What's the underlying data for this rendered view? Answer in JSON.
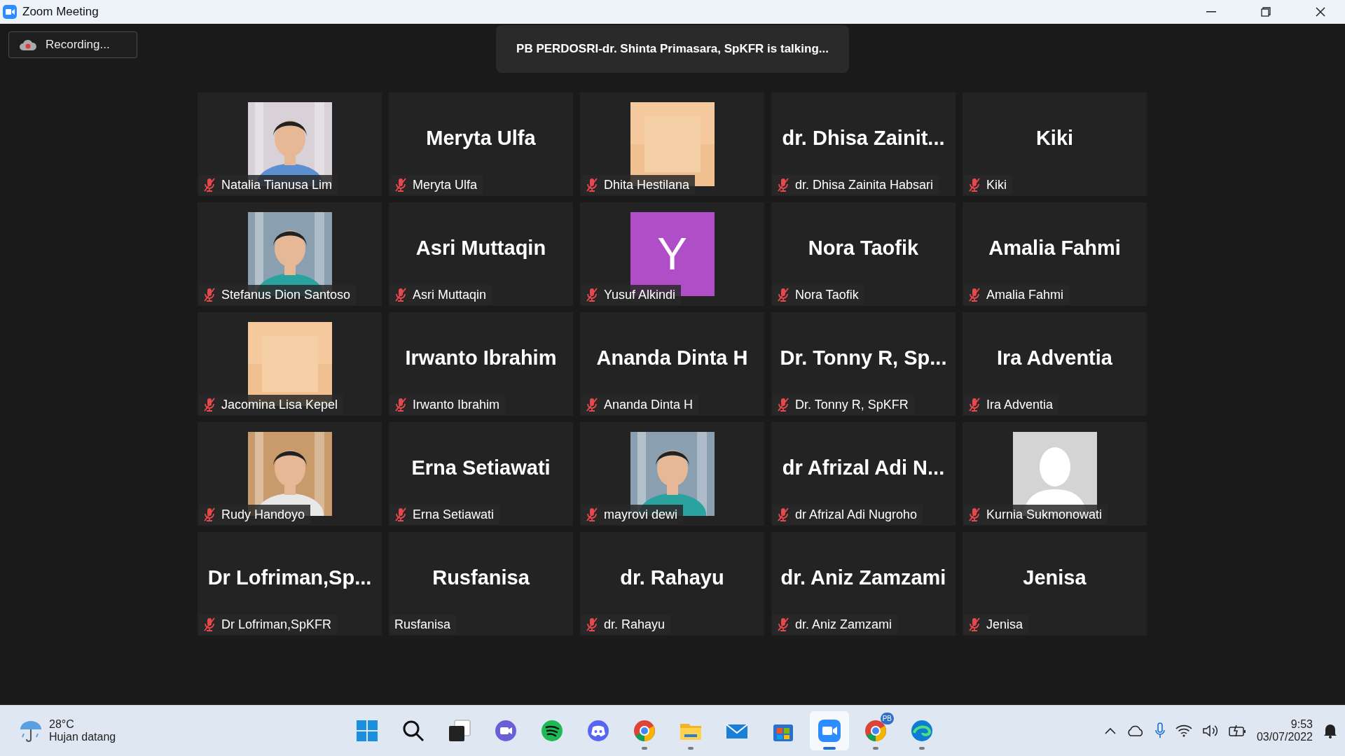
{
  "window": {
    "title": "Zoom Meeting"
  },
  "recording": {
    "label": "Recording..."
  },
  "speaker_banner": {
    "text": "PB PERDOSRI-dr. Shinta Primasara, SpKFR is talking..."
  },
  "tiles": [
    {
      "label": "Natalia Tianusa Lim",
      "muted": true
    },
    {
      "kind": "name",
      "display": "Meryta Ulfa",
      "label": "Meryta Ulfa",
      "muted": true
    },
    {
      "label": "Dhita Hestilana",
      "muted": true
    },
    {
      "kind": "name",
      "display": "dr. Dhisa Zainit...",
      "label": "dr. Dhisa Zainita Habsari",
      "muted": true
    },
    {
      "kind": "name",
      "display": "Kiki",
      "label": "Kiki",
      "muted": true
    },
    {
      "label": "Stefanus Dion Santoso",
      "muted": true
    },
    {
      "kind": "name",
      "display": "Asri Muttaqin",
      "label": "Asri Muttaqin",
      "muted": true
    },
    {
      "kind": "avatar",
      "letter": "Y",
      "color": "#b04ec8",
      "label": "Yusuf Alkindi",
      "muted": true
    },
    {
      "kind": "name",
      "display": "Nora Taofik",
      "label": "Nora Taofik",
      "muted": true
    },
    {
      "kind": "name",
      "display": "Amalia Fahmi",
      "label": "Amalia Fahmi",
      "muted": true
    },
    {
      "label": "Jacomina Lisa Kepel",
      "muted": true
    },
    {
      "kind": "name",
      "display": "Irwanto Ibrahim",
      "label": "Irwanto Ibrahim",
      "muted": true
    },
    {
      "kind": "name",
      "display": "Ananda Dinta H",
      "label": "Ananda Dinta H",
      "muted": true
    },
    {
      "kind": "name",
      "display": "Dr. Tonny R, Sp...",
      "label": "Dr. Tonny R, SpKFR",
      "muted": true
    },
    {
      "kind": "name",
      "display": "Ira Adventia",
      "label": "Ira Adventia",
      "muted": true
    },
    {
      "label": "Rudy Handoyo",
      "muted": true
    },
    {
      "kind": "name",
      "display": "Erna Setiawati",
      "label": "Erna Setiawati",
      "muted": true
    },
    {
      "label": "mayrovi dewi",
      "muted": true
    },
    {
      "kind": "name",
      "display": "dr Afrizal Adi N...",
      "label": "dr Afrizal Adi Nugroho",
      "muted": true
    },
    {
      "kind": "silhouette",
      "label": "Kurnia Sukmonowati",
      "muted": true
    },
    {
      "kind": "name",
      "display": "Dr  Lofriman,Sp...",
      "label": "Dr Lofriman,SpKFR",
      "muted": true
    },
    {
      "kind": "name",
      "display": "Rusfanisa",
      "label": "Rusfanisa",
      "muted": false
    },
    {
      "kind": "name",
      "display": "dr. Rahayu",
      "label": "dr. Rahayu",
      "muted": true
    },
    {
      "kind": "name",
      "display": "dr. Aniz Zamzami",
      "label": "dr. Aniz Zamzami",
      "muted": true
    },
    {
      "kind": "name",
      "display": "Jenisa",
      "label": "Jenisa",
      "muted": true
    }
  ],
  "taskbar": {
    "weather": {
      "temp": "28°C",
      "text": "Hujan datang"
    },
    "apps": [
      {
        "kind": "start",
        "running": false,
        "selected": false
      },
      {
        "kind": "search",
        "running": false,
        "selected": false
      },
      {
        "kind": "taskview",
        "running": false,
        "selected": false
      },
      {
        "kind": "chat",
        "running": false,
        "selected": false
      },
      {
        "kind": "music",
        "running": false,
        "selected": false
      },
      {
        "kind": "discord",
        "running": false,
        "selected": false
      },
      {
        "kind": "chrome",
        "running": true,
        "selected": false
      },
      {
        "kind": "folder",
        "running": true,
        "selected": false
      },
      {
        "kind": "mail",
        "running": false,
        "selected": false
      },
      {
        "kind": "store",
        "running": false,
        "selected": false
      },
      {
        "kind": "zoom",
        "running": true,
        "selected": true
      },
      {
        "kind": "chrome",
        "running": true,
        "selected": false,
        "badge": "PB"
      },
      {
        "kind": "edge",
        "running": true,
        "selected": false
      }
    ],
    "time": "9:53",
    "date": "03/07/2022"
  }
}
